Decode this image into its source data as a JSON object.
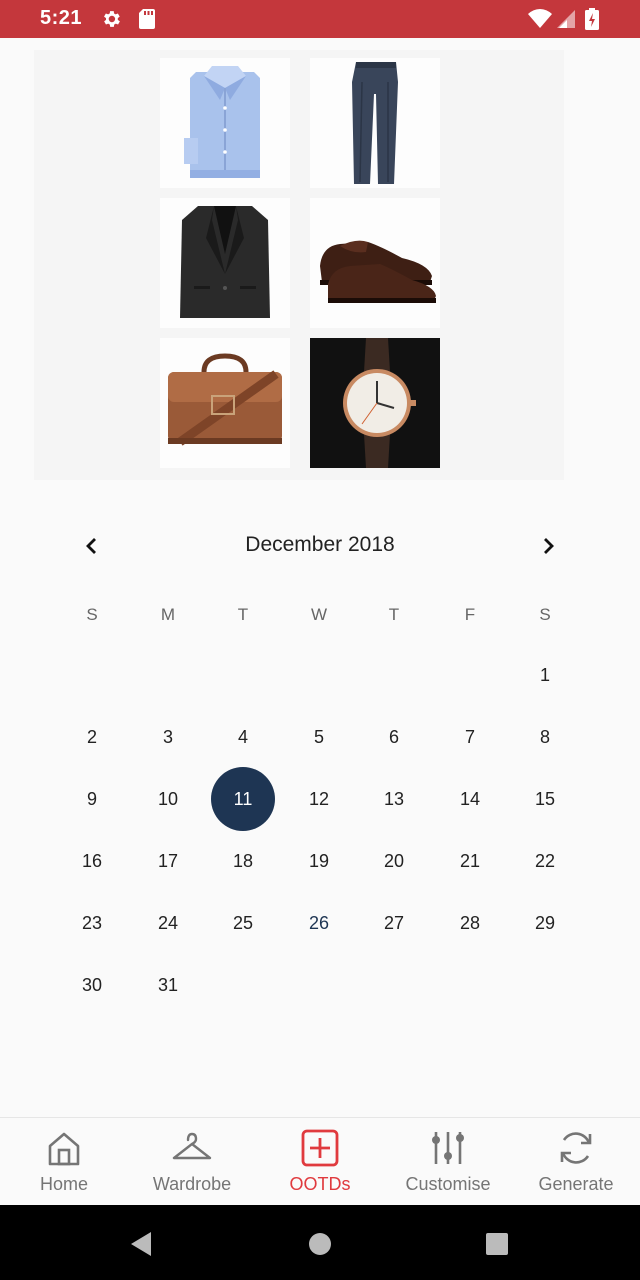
{
  "status_bar": {
    "time": "5:21"
  },
  "outfit": {
    "items": [
      {
        "name": "dress-shirt"
      },
      {
        "name": "trousers"
      },
      {
        "name": "blazer"
      },
      {
        "name": "oxford-shoes"
      },
      {
        "name": "leather-briefcase"
      },
      {
        "name": "wristwatch"
      }
    ]
  },
  "calendar": {
    "title": "December 2018",
    "weekdays": [
      "S",
      "M",
      "T",
      "W",
      "T",
      "F",
      "S"
    ],
    "days": [
      "1",
      "2",
      "3",
      "4",
      "5",
      "6",
      "7",
      "8",
      "9",
      "10",
      "11",
      "12",
      "13",
      "14",
      "15",
      "16",
      "17",
      "18",
      "19",
      "20",
      "21",
      "22",
      "23",
      "24",
      "25",
      "26",
      "27",
      "28",
      "29",
      "30",
      "31"
    ],
    "selected_day": "11",
    "today": "26"
  },
  "bottom_nav": {
    "items": [
      {
        "label": "Home",
        "icon": "home-icon"
      },
      {
        "label": "Wardrobe",
        "icon": "hanger-icon"
      },
      {
        "label": "OOTDs",
        "icon": "add-box-icon"
      },
      {
        "label": "Customise",
        "icon": "sliders-icon"
      },
      {
        "label": "Generate",
        "icon": "refresh-icon"
      }
    ],
    "active": "OOTDs"
  },
  "colors": {
    "status_bar": "#c4373c",
    "accent": "#e03a3e",
    "selected": "#1e3553"
  }
}
